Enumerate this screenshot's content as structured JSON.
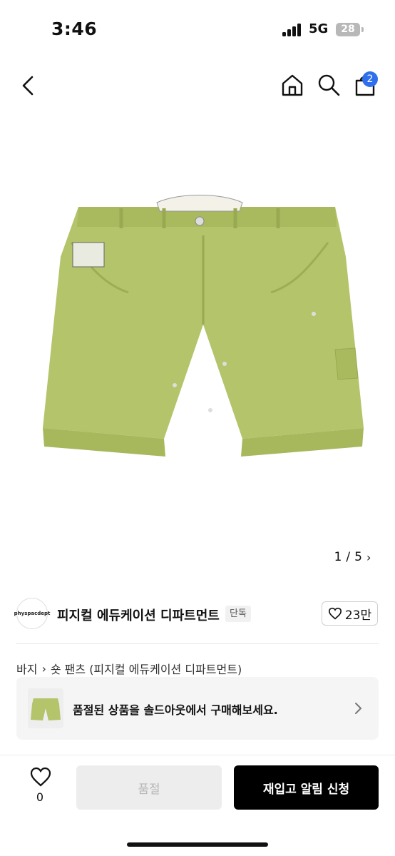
{
  "status_bar": {
    "time": "3:46",
    "network": "5G",
    "battery": "28"
  },
  "nav": {
    "cart_count": "2",
    "icons": [
      "chevron-left-icon",
      "home-icon",
      "search-icon",
      "bag-icon"
    ]
  },
  "gallery": {
    "current": "1",
    "separator": "/",
    "total": "5"
  },
  "brand": {
    "logo_text": "physpacdept",
    "name": "피지컬 에듀케이션 디파트먼트",
    "tag": "단독",
    "likes": "23만"
  },
  "breadcrumb": {
    "category": "바지",
    "subcategory": "숏 팬츠 (피지컬 에듀케이션 디파트먼트)"
  },
  "soldout_notice": {
    "text": "품절된 상품을 솔드아웃에서 구매해보세요."
  },
  "bottom_bar": {
    "wish_count": "0",
    "soldout_label": "품절",
    "restock_label": "재입고 알림 신청"
  },
  "colors": {
    "accent": "#2f6fec",
    "shorts": "#b3c46a",
    "primary_button": "#000000"
  }
}
